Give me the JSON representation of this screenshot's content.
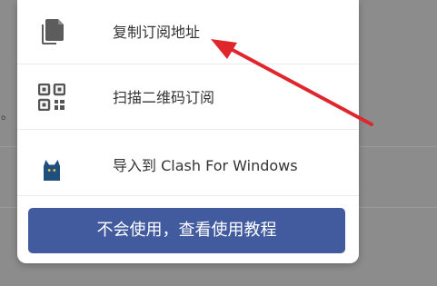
{
  "popup": {
    "items": [
      {
        "label": "复制订阅地址",
        "icon": "copy-icon"
      },
      {
        "label": "扫描二维码订阅",
        "icon": "qr-code-icon"
      },
      {
        "label": "导入到 Clash For Windows",
        "icon": "clash-cat-icon"
      }
    ],
    "help_button": "不会使用，查看使用教程"
  },
  "background": {
    "fragment": "。"
  },
  "colors": {
    "button": "#415b9e",
    "arrow": "#e0262d",
    "text": "#333333",
    "icon": "#555555",
    "cat": "#1f4f7a"
  }
}
